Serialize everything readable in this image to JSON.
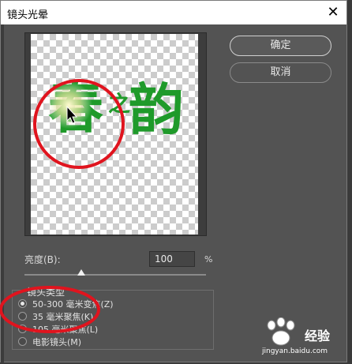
{
  "dialog": {
    "title": "镜头光晕",
    "close_glyph": "✕"
  },
  "buttons": {
    "ok_label": "确定",
    "cancel_label": "取消"
  },
  "preview": {
    "text_char_1": "春",
    "text_char_2": "之",
    "text_char_3": "韵",
    "text_color": "#1f9a2a"
  },
  "brightness": {
    "label": "亮度(B):",
    "value": "100",
    "unit": "%",
    "slider_level_percent": 100
  },
  "lens_type": {
    "legend": "镜头类型",
    "options": [
      {
        "label": "50-300 毫米变焦(Z)",
        "selected": true
      },
      {
        "label": "35 毫米聚焦(K)",
        "selected": false
      },
      {
        "label": "105 毫米聚焦(L)",
        "selected": false
      },
      {
        "label": "电影镜头(M)",
        "selected": false
      }
    ]
  },
  "watermark": {
    "brand": "经验",
    "url": "jingyan.baidu.com"
  },
  "colors": {
    "dialog_bg": "#535353",
    "annotation_red": "#e0141e"
  }
}
